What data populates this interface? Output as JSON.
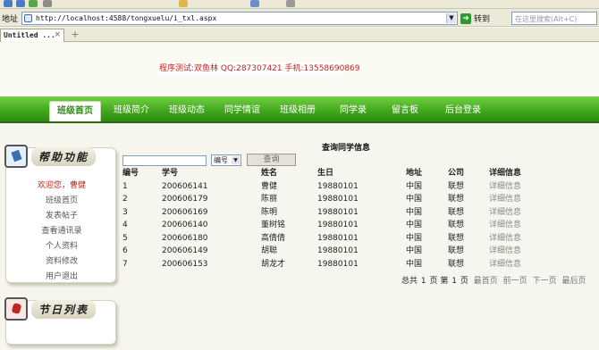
{
  "browser": {
    "address_label": "地址",
    "url": "http://localhost:4588/tongxuelu/i_txl.aspx",
    "go_label": "转到",
    "search_placeholder": "在这里搜索(Alt+C)",
    "tab_title": "Untitled ...",
    "tab_close": "×",
    "new_tab": "+"
  },
  "header": {
    "dev_info": "程序测试:双鱼林 QQ:287307421 手机:13558690869"
  },
  "nav": {
    "items": [
      "班级首页",
      "班级简介",
      "班级动态",
      "同学情谊",
      "班级相册",
      "同学录",
      "留言板",
      "后台登录"
    ],
    "active_index": 0
  },
  "sidebar": {
    "panel1_title": "帮助功能",
    "panel2_title": "节日列表",
    "links": [
      "欢迎您，曹健",
      "班级首页",
      "发表帖子",
      "查看通讯录",
      "个人资料",
      "资料修改",
      "用户退出"
    ]
  },
  "search": {
    "select_value": "编号",
    "button_label": "查询"
  },
  "content": {
    "title": "查询同学信息",
    "columns": [
      "编号",
      "学号",
      "姓名",
      "生日",
      "地址",
      "公司",
      "详细信息"
    ],
    "rows": [
      [
        "1",
        "200606141",
        "曹健",
        "19880101",
        "中国",
        "联想",
        "详细信息"
      ],
      [
        "2",
        "200606179",
        "陈丽",
        "19880101",
        "中国",
        "联想",
        "详细信息"
      ],
      [
        "3",
        "200606169",
        "陈明",
        "19880101",
        "中国",
        "联想",
        "详细信息"
      ],
      [
        "4",
        "200606140",
        "董树铭",
        "19880101",
        "中国",
        "联想",
        "详细信息"
      ],
      [
        "5",
        "200606180",
        "高倩倩",
        "19880101",
        "中国",
        "联想",
        "详细信息"
      ],
      [
        "6",
        "200606149",
        "胡聪",
        "19880101",
        "中国",
        "联想",
        "详细信息"
      ],
      [
        "7",
        "200606153",
        "胡龙才",
        "19880101",
        "中国",
        "联想",
        "详细信息"
      ]
    ]
  },
  "pager": {
    "total_label": "总共",
    "total_pages": "1",
    "page_unit": "页",
    "current_label": "第",
    "current_page": "1",
    "first": "最首页",
    "prev": "前一页",
    "next": "下一页",
    "last": "最后页"
  },
  "colors": {
    "nav_green": "#3fa51b",
    "dev_info_red": "#c0241d"
  }
}
